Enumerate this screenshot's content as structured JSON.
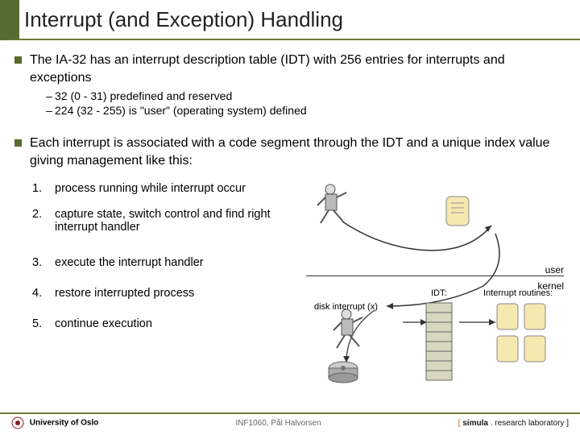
{
  "title": "Interrupt (and Exception) Handling",
  "bullets": {
    "b1": "The IA-32 has an interrupt description table (IDT) with 256 entries for interrupts and exceptions",
    "b1_subs": {
      "s1": "32 (0 - 31) predefined and reserved",
      "s2": "224 (32 - 255) is \"user\" (operating system) defined"
    },
    "b2": "Each interrupt is associated with a code segment through the IDT and a unique index value giving management like this:"
  },
  "steps": {
    "n1": "process running while interrupt occur",
    "n2": "capture state, switch control and find right interrupt handler",
    "n3": "execute the interrupt handler",
    "n4": "restore interrupted process",
    "n5": "continue execution"
  },
  "labels": {
    "user": "user",
    "kernel": "kernel",
    "disk_interrupt": "disk interrupt (x)",
    "idt": "IDT:",
    "ir": "Interrupt routines:"
  },
  "footer": {
    "left": "University of Oslo",
    "mid": "INF1060, Pål Halvorsen",
    "right_prefix": "[ ",
    "right_simula": "simula",
    "right_rest": " . research laboratory ]"
  }
}
